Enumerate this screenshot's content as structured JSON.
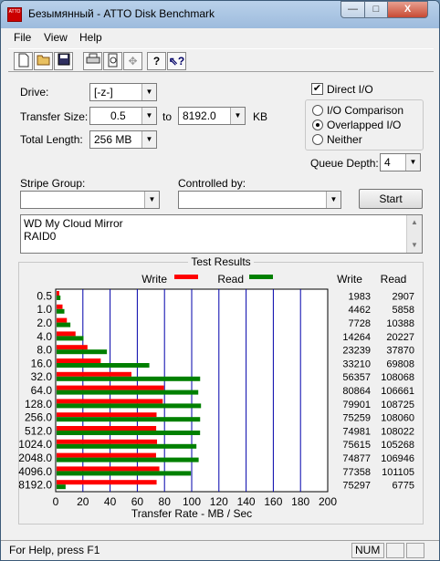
{
  "window": {
    "title": "Безымянный - ATTO Disk Benchmark",
    "icon_text": "ATTO",
    "minimize": "—",
    "maximize": "□",
    "close": "X"
  },
  "menu": {
    "items": [
      "File",
      "View",
      "Help"
    ]
  },
  "toolbar": {
    "icons": [
      "new-icon",
      "open-icon",
      "save-icon",
      "print-icon",
      "print-preview-icon",
      "move-icon",
      "help-icon",
      "context-help-icon"
    ]
  },
  "form": {
    "drive_label": "Drive:",
    "drive_value": "[-z-]",
    "transfer_size_label": "Transfer Size:",
    "transfer_from": "0.5",
    "to_label": "to",
    "transfer_to": "8192.0",
    "kb_label": "KB",
    "total_length_label": "Total Length:",
    "total_length_value": "256 MB",
    "direct_io_label": "Direct I/O",
    "direct_io_checked": true,
    "io_options": [
      "I/O Comparison",
      "Overlapped I/O",
      "Neither"
    ],
    "io_selected": "Overlapped I/O",
    "queue_depth_label": "Queue Depth:",
    "queue_depth_value": "4",
    "stripe_group_label": "Stripe Group:",
    "stripe_group_value": "",
    "controlled_by_label": "Controlled by:",
    "controlled_by_value": "",
    "start_button": "Start",
    "description_lines": [
      "WD My Cloud Mirror",
      "RAID0"
    ]
  },
  "results": {
    "title": "Test Results",
    "legend_write": "Write",
    "legend_read": "Read",
    "col_write": "Write",
    "col_read": "Read",
    "xlabel": "Transfer Rate - MB / Sec",
    "write_color": "#ff0000",
    "read_color": "#008000"
  },
  "chart_data": {
    "type": "bar",
    "orientation": "horizontal",
    "categories": [
      "0.5",
      "1.0",
      "2.0",
      "4.0",
      "8.0",
      "16.0",
      "32.0",
      "64.0",
      "128.0",
      "256.0",
      "512.0",
      "1024.0",
      "2048.0",
      "4096.0",
      "8192.0"
    ],
    "series": [
      {
        "name": "Write",
        "values": [
          1983,
          4462,
          7728,
          14264,
          23239,
          33210,
          56357,
          80864,
          79901,
          75259,
          74981,
          75615,
          74877,
          77358,
          75297
        ]
      },
      {
        "name": "Read",
        "values": [
          2907,
          5858,
          10388,
          20227,
          37870,
          69808,
          108068,
          106661,
          108725,
          108060,
          108022,
          105268,
          106946,
          101105,
          6775
        ]
      }
    ],
    "value_unit_note": "KB/s",
    "x_ticks": [
      "0",
      "20",
      "40",
      "60",
      "80",
      "100",
      "120",
      "140",
      "160",
      "180",
      "200"
    ],
    "xlim": [
      0,
      200
    ],
    "xlabel": "Transfer Rate - MB / Sec",
    "legend_position": "top"
  },
  "status": {
    "text": "For Help, press F1",
    "num": "NUM"
  }
}
